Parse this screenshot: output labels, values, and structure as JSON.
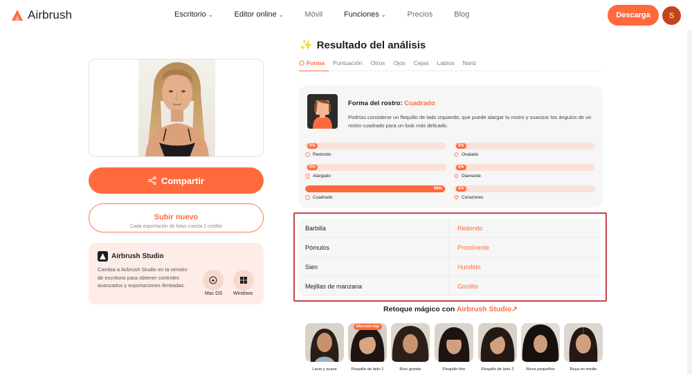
{
  "header": {
    "brand": "Airbrush",
    "nav": [
      {
        "label": "Escritorio",
        "has_dropdown": true
      },
      {
        "label": "Editor online",
        "has_dropdown": true
      },
      {
        "label": "Móvil",
        "has_dropdown": false
      },
      {
        "label": "Funciones",
        "has_dropdown": true
      },
      {
        "label": "Precios",
        "has_dropdown": false
      },
      {
        "label": "Blog",
        "has_dropdown": false
      }
    ],
    "download_label": "Descarga",
    "avatar_initial": "S"
  },
  "left": {
    "share_label": "Compartir",
    "upload_label": "Subir nuevo",
    "upload_note": "Cada exportación de fotos cuesta 1 crédito",
    "studio": {
      "title": "Airbrush Studio",
      "description": "Cambia a Airbrush Studio en la versión de escritorio para obtener controles avanzados y exportaciones ilimitadas.",
      "platforms": [
        {
          "label": "Mac OS",
          "icon": "apple-icon"
        },
        {
          "label": "Windows",
          "icon": "windows-icon"
        }
      ]
    }
  },
  "result": {
    "title": "Resultado del análisis",
    "tabs": [
      "Forma",
      "Puntuación",
      "Otros",
      "Ojos",
      "Cejas",
      "Labios",
      "Nariz"
    ],
    "active_tab": "Forma",
    "shape": {
      "label": "Forma del rostro:",
      "value": "Cuadrado",
      "description": "Podrías considerar un flequillo de lado izquierdo, que puede alargar tu rostro y suavizar los ángulos de un rostro cuadrado para un look más delicado.",
      "scores": [
        {
          "name": "Redondo",
          "percent": 0,
          "pct_label": "0%",
          "icon": "circle-icon"
        },
        {
          "name": "Ovalado",
          "percent": 0,
          "pct_label": "0%",
          "icon": "oval-icon"
        },
        {
          "name": "Alargado",
          "percent": 0,
          "pct_label": "0%",
          "icon": "rectangle-icon"
        },
        {
          "name": "Diamante",
          "percent": 0,
          "pct_label": "0%",
          "icon": "diamond-icon"
        },
        {
          "name": "Cuadrado",
          "percent": 99,
          "pct_label": "99%",
          "icon": "square-icon"
        },
        {
          "name": "Corazones",
          "percent": 0,
          "pct_label": "0%",
          "icon": "heart-icon"
        }
      ]
    },
    "attributes": [
      {
        "name": "Barbilla",
        "value": "Redondo"
      },
      {
        "name": "Pómulos",
        "value": "Prominente"
      },
      {
        "name": "Sien",
        "value": "Hundido"
      },
      {
        "name": "Mejillas de manzana",
        "value": "Gordito"
      }
    ],
    "retouch": {
      "prefix": "Retoque mágico con",
      "link": "Airbrush Studio↗",
      "badge": "Elección top",
      "styles": [
        {
          "label": "Lacio y suave"
        },
        {
          "label": "Flequillo de lado 1",
          "top_pick": true
        },
        {
          "label": "Rizo grande"
        },
        {
          "label": "Flequillo fino"
        },
        {
          "label": "Flequillo de lado 2"
        },
        {
          "label": "Rizos pequeños"
        },
        {
          "label": "Raya en medio"
        }
      ]
    }
  },
  "colors": {
    "accent": "#ff6a3d",
    "highlight_border": "#c5444a",
    "avatar": "#c4431b"
  }
}
